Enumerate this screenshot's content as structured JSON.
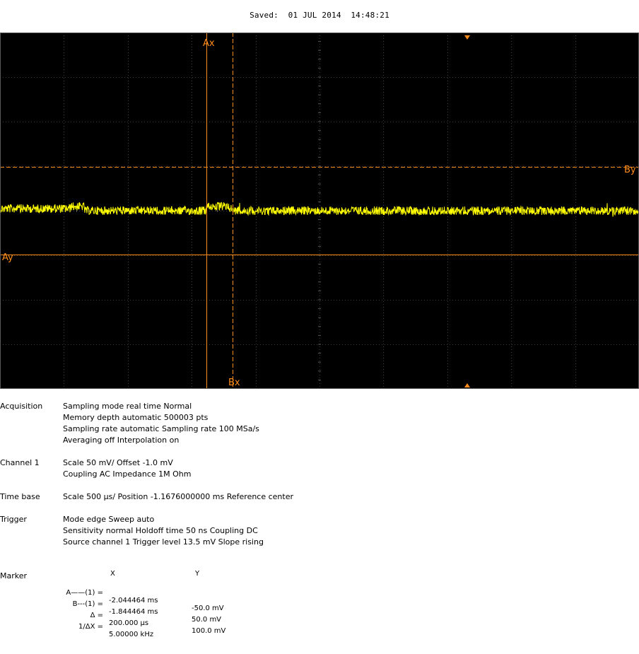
{
  "header": {
    "saved": "Saved:  01 JUL 2014  14:48:21"
  },
  "scope": {
    "colors": {
      "background": "#000000",
      "grid": "#3c3c3c",
      "trace": "#ffff00",
      "cursor": "#ff8c1a",
      "border": "#5a5a5a"
    },
    "cursor_labels": {
      "ax": "Ax",
      "bx": "Bx",
      "ay": "Ay",
      "by": "By"
    },
    "trigger_marker_icon": "triangle-marker-icon"
  },
  "info": {
    "acquisition": {
      "label": "Acquisition",
      "lines": [
        "Sampling mode real time Normal",
        "Memory depth automatic 500003 pts",
        "Sampling rate automatic Sampling rate 100 MSa/s",
        "Averaging off Interpolation on"
      ]
    },
    "channel1": {
      "label": "Channel 1",
      "lines": [
        "Scale 50 mV/ Offset -1.0 mV",
        "Coupling AC Impedance 1M Ohm"
      ]
    },
    "timebase": {
      "label": "Time base",
      "lines": [
        "Scale 500 µs/ Position -1.1676000000 ms Reference center"
      ]
    },
    "trigger": {
      "label": "Trigger",
      "lines": [
        "Mode edge Sweep auto",
        "Sensitivity normal Holdoff time 50 ns Coupling DC",
        "Source channel 1 Trigger level 13.5 mV Slope rising"
      ]
    }
  },
  "marker": {
    "label": "Marker",
    "col_x": "X",
    "col_y": "Y",
    "rows": [
      {
        "name": "A——(1) =",
        "x": "-2.044464 ms",
        "y": "-50.0 mV"
      },
      {
        "name": "B---(1) =",
        "x": "-1.844464 ms",
        "y": "50.0 mV"
      },
      {
        "name": "Δ =",
        "x": "200.000 µs",
        "y": "100.0 mV"
      },
      {
        "name": "1/ΔX =",
        "x": "5.00000 kHz",
        "y": ""
      }
    ]
  }
}
